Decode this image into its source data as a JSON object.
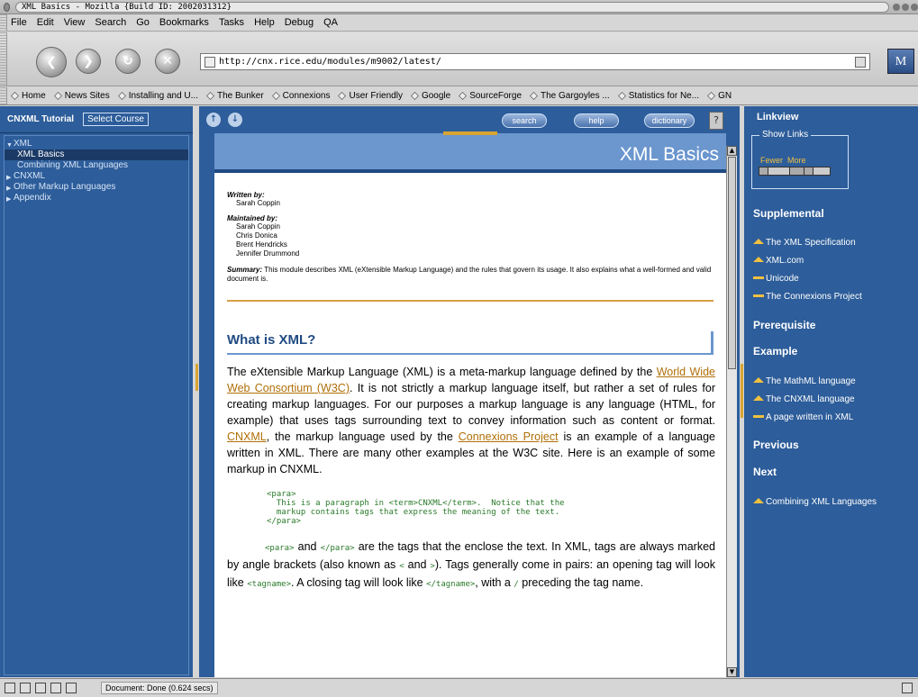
{
  "window": {
    "title": "XML Basics - Mozilla {Build ID: 2002031312}"
  },
  "menu": [
    "File",
    "Edit",
    "View",
    "Search",
    "Go",
    "Bookmarks",
    "Tasks",
    "Help",
    "Debug",
    "QA"
  ],
  "navigation": {
    "url": "http://cnx.rice.edu/modules/m9002/latest/"
  },
  "bookmarks": [
    "Home",
    "News Sites",
    "Installing and U...",
    "The Bunker",
    "Connexions",
    "User Friendly",
    "Google",
    "SourceForge",
    "The Gargoyles ...",
    "Statistics for Ne...",
    "GN"
  ],
  "sidebar": {
    "title": "CNXML Tutorial",
    "select_course": "Select Course",
    "tree": [
      {
        "label": "XML",
        "level": 0,
        "expanded": true
      },
      {
        "label": "XML Basics",
        "level": 1,
        "active": true
      },
      {
        "label": "Combining XML Languages",
        "level": 1
      },
      {
        "label": "CNXML",
        "level": 0
      },
      {
        "label": "Other Markup Languages",
        "level": 0
      },
      {
        "label": "Appendix",
        "level": 0
      }
    ]
  },
  "content_toolbar": {
    "search": "search",
    "help": "help",
    "dictionary": "dictionary",
    "question": "?",
    "up_arrow": "↑",
    "down_arrow": "↓"
  },
  "page": {
    "title": "XML Basics",
    "written_by_label": "Written by:",
    "authors": [
      "Sarah Coppin"
    ],
    "maintained_by_label": "Maintained by:",
    "maintainers": [
      "Sarah Coppin",
      "Chris Donica",
      "Brent Hendricks",
      "Jennifer Drummond"
    ],
    "summary_label": "Summary:",
    "summary": "This module describes XML (eXtensible Markup Language) and the rules that govern its usage. It also explains what a well-formed and valid document is.",
    "section_title": "What is XML?",
    "para1": {
      "t1": "The eXtensible Markup Language (XML) is a meta-markup language defined by the ",
      "link1": "World Wide Web Consortium (W3C)",
      "t2": ". It is not strictly a markup language itself, but rather a set of rules for creating markup languages. For our purposes a markup language is any language (HTML, for example) that uses tags surrounding text to convey information such as content or format. ",
      "link2": "CNXML",
      "t3": ", the markup language used by the ",
      "link3": "Connexions Project",
      "t4": " is an example of a language written in XML. There are many other examples at the W3C site. Here is an example of some markup in CNXML."
    },
    "code": "<para>\n  This is a paragraph in <term>CNXML</term>.  Notice that the\n  markup contains tags that express the meaning of the text.\n</para>",
    "para2": {
      "c1": "<para>",
      "t1": " and ",
      "c2": "</para>",
      "t2": " are the tags that the enclose the text. In XML, tags are always marked by angle brackets (also known as ",
      "c3": "<",
      "t3": " and ",
      "c4": ">",
      "t4": "). Tags generally come in pairs: an opening tag will look like ",
      "c5": "<tagname>",
      "t5": ". A closing tag will look like ",
      "c6": "</tagname>",
      "t6": ", with a ",
      "c7": "/",
      "t7": " preceding the tag name."
    }
  },
  "linkview": {
    "title": "Linkview",
    "show_links": "Show Links",
    "fewer": "Fewer",
    "more": "More",
    "supplemental": "Supplemental",
    "supplemental_links": [
      "The XML Specification",
      "XML.com",
      "Unicode",
      "The Connexions Project"
    ],
    "prerequisite": "Prerequisite",
    "example": "Example",
    "example_links": [
      "The MathML language",
      "The CNXML language",
      "A page written in XML"
    ],
    "previous": "Previous",
    "next": "Next",
    "next_links": [
      "Combining XML Languages"
    ]
  },
  "status": {
    "text": "Document: Done (0.624 secs)"
  },
  "colors": {
    "panel_blue": "#2d5d9a",
    "header_blue": "#6b96ce",
    "accent_gold": "#d8a432",
    "link_brown": "#b06f08"
  }
}
